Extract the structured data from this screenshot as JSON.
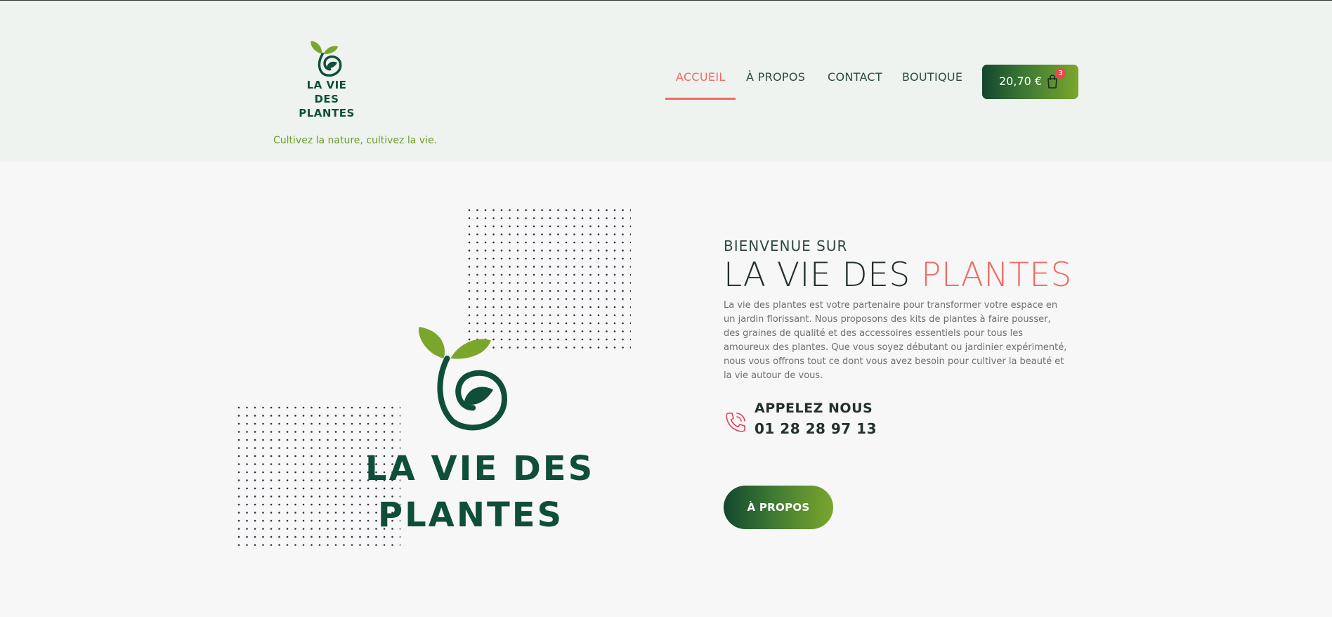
{
  "header": {
    "logo_text": "LA VIE DES PLANTES",
    "logo_line1": "LA VIE DES",
    "logo_line2": "PLANTES",
    "tagline": "Cultivez la nature, cultivez la vie.",
    "nav": [
      {
        "label": "ACCUEIL",
        "active": true
      },
      {
        "label": "À PROPOS",
        "active": false
      },
      {
        "label": "CONTACT",
        "active": false
      },
      {
        "label": "BOUTIQUE",
        "active": false
      }
    ],
    "cart": {
      "total": "20,70 €",
      "count": "3",
      "icon": "shopping-bag-icon"
    }
  },
  "hero": {
    "logo_line1": "LA VIE DES",
    "logo_line2": "PLANTES",
    "welcome": "BIENVENUE SUR",
    "headline_main": "LA VIE DES ",
    "headline_accent": "PLANTES",
    "description": "La vie des plantes est votre partenaire pour transformer votre espace en un jardin florissant. Nous proposons des kits de plantes à faire pousser, des graines de qualité et des accessoires essentiels pour tous les amoureux des plantes. Que vous soyez débutant ou jardinier expérimenté, nous vous offrons tout ce dont vous avez besoin pour cultiver la beauté et la vie autour de vous.",
    "call_label": "APPELEZ NOUS",
    "phone": "01 28 28 97 13",
    "phone_icon": "phone-icon",
    "button_label": "À PROPOS"
  },
  "colors": {
    "accent": "#ef6b66",
    "brand_dark": "#0f4f3a",
    "brand_light": "#7ba62c",
    "header_bg": "#eef3ef"
  }
}
